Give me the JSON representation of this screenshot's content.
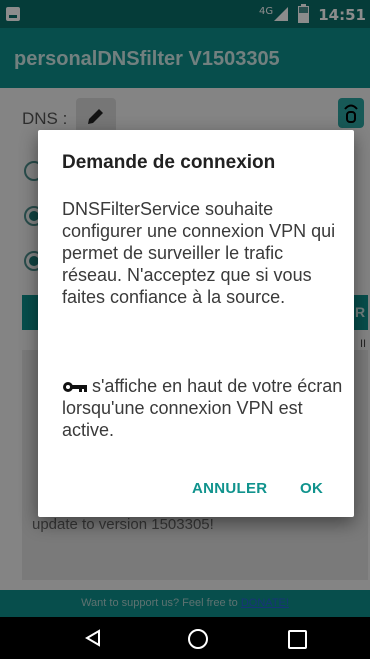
{
  "status_bar": {
    "network": "4G",
    "time": "14:51"
  },
  "app": {
    "title": "personalDNSfilter V1503305"
  },
  "main": {
    "dns_label": "DNS :",
    "right_letter": "II",
    "log_text": "update to version 1503305!"
  },
  "footer": {
    "text": "Want to support us? Feel free to ",
    "link": "DONATE!"
  },
  "dialog": {
    "title": "Demande de connexion",
    "body": "DNSFilterService souhaite configurer une connexion VPN qui permet de surveiller le trafic réseau. N'acceptez que si vous faites confiance à la source.",
    "note": "s'affiche en haut de votre écran lorsqu'une connexion VPN est active.",
    "cancel_label": "ANNULER",
    "ok_label": "OK"
  },
  "colors": {
    "primary": "#0e8f8b",
    "status": "#0a6d69",
    "accent": "#10938d"
  }
}
